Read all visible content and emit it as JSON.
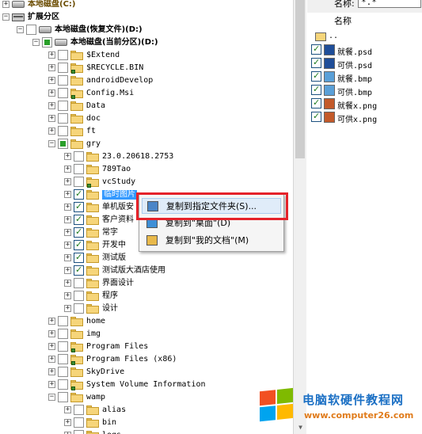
{
  "tree": {
    "items": [
      {
        "label": "本地磁盘(C:)",
        "level": 0,
        "kind": "drive",
        "state": "none",
        "bold": true
      },
      {
        "label": "扩展分区",
        "level": 0,
        "kind": "ext",
        "state": "none",
        "bold": true
      },
      {
        "label": "本地磁盘(恢复文件)(D:)",
        "level": 1,
        "kind": "drive",
        "state": "none",
        "bold": true
      },
      {
        "label": "本地磁盘(当前分区)(D:)",
        "level": 2,
        "kind": "drive",
        "state": "partial",
        "bold": true
      },
      {
        "label": "$Extend",
        "level": 3,
        "kind": "folder",
        "state": "none"
      },
      {
        "label": "$RECYCLE.BIN",
        "level": 3,
        "kind": "folder-lock",
        "state": "none"
      },
      {
        "label": "androidDevelop",
        "level": 3,
        "kind": "folder",
        "state": "none"
      },
      {
        "label": "Config.Msi",
        "level": 3,
        "kind": "folder-lock",
        "state": "none"
      },
      {
        "label": "Data",
        "level": 3,
        "kind": "folder",
        "state": "none"
      },
      {
        "label": "doc",
        "level": 3,
        "kind": "folder",
        "state": "none"
      },
      {
        "label": "ft",
        "level": 3,
        "kind": "folder",
        "state": "none"
      },
      {
        "label": "gry",
        "level": 3,
        "kind": "folder",
        "state": "partial"
      },
      {
        "label": "23.0.20618.2753",
        "level": 4,
        "kind": "folder",
        "state": "none"
      },
      {
        "label": "789Tao",
        "level": 4,
        "kind": "folder",
        "state": "none"
      },
      {
        "label": "vcStudy",
        "level": 4,
        "kind": "folder-lock",
        "state": "none"
      },
      {
        "label": "临时图片",
        "level": 4,
        "kind": "folder",
        "state": "checked",
        "selected": true
      },
      {
        "label": "单机版安",
        "level": 4,
        "kind": "folder",
        "state": "checked"
      },
      {
        "label": "客户资料",
        "level": 4,
        "kind": "folder",
        "state": "checked"
      },
      {
        "label": "常字",
        "level": 4,
        "kind": "folder",
        "state": "checked"
      },
      {
        "label": "开发中",
        "level": 4,
        "kind": "folder",
        "state": "checked"
      },
      {
        "label": "测试版",
        "level": 4,
        "kind": "folder",
        "state": "checked"
      },
      {
        "label": "测试版大酒店使用",
        "level": 4,
        "kind": "folder",
        "state": "checked"
      },
      {
        "label": "界面设计",
        "level": 4,
        "kind": "folder",
        "state": "none"
      },
      {
        "label": "程序",
        "level": 4,
        "kind": "folder",
        "state": "none"
      },
      {
        "label": "设计",
        "level": 4,
        "kind": "folder",
        "state": "none"
      },
      {
        "label": "home",
        "level": 3,
        "kind": "folder",
        "state": "none"
      },
      {
        "label": "img",
        "level": 3,
        "kind": "folder",
        "state": "none"
      },
      {
        "label": "Program Files",
        "level": 3,
        "kind": "folder-lock",
        "state": "none"
      },
      {
        "label": "Program Files (x86)",
        "level": 3,
        "kind": "folder-lock",
        "state": "none"
      },
      {
        "label": "SkyDrive",
        "level": 3,
        "kind": "folder",
        "state": "none"
      },
      {
        "label": "System Volume Information",
        "level": 3,
        "kind": "folder-lock",
        "state": "none"
      },
      {
        "label": "wamp",
        "level": 3,
        "kind": "folder",
        "state": "none"
      },
      {
        "label": "alias",
        "level": 4,
        "kind": "folder",
        "state": "none"
      },
      {
        "label": "bin",
        "level": 4,
        "kind": "folder",
        "state": "none"
      },
      {
        "label": "logs",
        "level": 4,
        "kind": "folder",
        "state": "none"
      }
    ]
  },
  "context_menu": {
    "items": [
      {
        "label": "复制到指定文件夹(S)...",
        "icon": "folder-copy-icon"
      },
      {
        "label": "复制到\"桌面\"(D)",
        "icon": "desktop-icon"
      },
      {
        "label": "复制到\"我的文档\"(M)",
        "icon": "documents-folder-icon"
      }
    ]
  },
  "right_pane": {
    "filter_label": "名称:",
    "filter_value": "*.*",
    "column_header": "名称",
    "files": [
      {
        "name": "..",
        "type": "parent",
        "checked": false
      },
      {
        "name": "就餐.psd",
        "type": "psd",
        "checked": true
      },
      {
        "name": "可供.psd",
        "type": "psd",
        "checked": true
      },
      {
        "name": "就餐.bmp",
        "type": "bmp",
        "checked": true
      },
      {
        "name": "可供.bmp",
        "type": "bmp",
        "checked": true
      },
      {
        "name": "就餐x.png",
        "type": "png",
        "checked": true
      },
      {
        "name": "可供x.png",
        "type": "png",
        "checked": true
      }
    ]
  },
  "watermark": {
    "title": "电脑软硬件教程网",
    "url": "www.computer26.com",
    "colors": {
      "red": "#f25022",
      "green": "#7fba00",
      "blue": "#00a4ef",
      "yellow": "#ffb900"
    }
  },
  "colors": {
    "selection": "#3399ff",
    "context_highlight": "#e5222a",
    "menu_hover": "#e0ecf9"
  }
}
